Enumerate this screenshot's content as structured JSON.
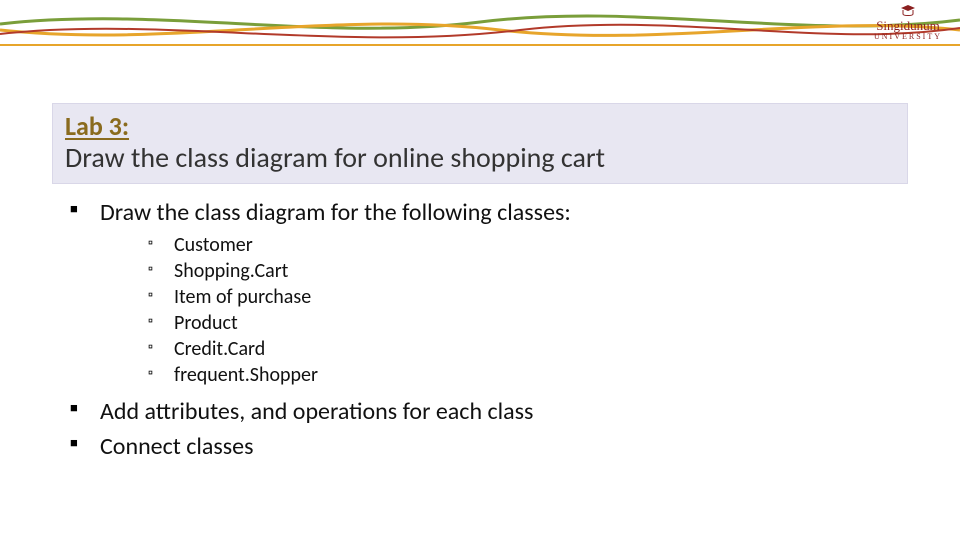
{
  "logo": {
    "name": "Singidunum",
    "subtitle": "UNIVERSITY"
  },
  "title": {
    "label": "Lab 3:",
    "subtitle": "Draw the class diagram for online shopping cart"
  },
  "content": {
    "items": [
      {
        "text": "Draw the class diagram for the following classes:",
        "subitems": [
          "Customer",
          "Shopping.Cart",
          "Item of purchase",
          "Product",
          "Credit.Card",
          "frequent.Shopper"
        ]
      },
      {
        "text": "Add attributes, and operations for each class"
      },
      {
        "text": "Connect classes"
      }
    ]
  }
}
